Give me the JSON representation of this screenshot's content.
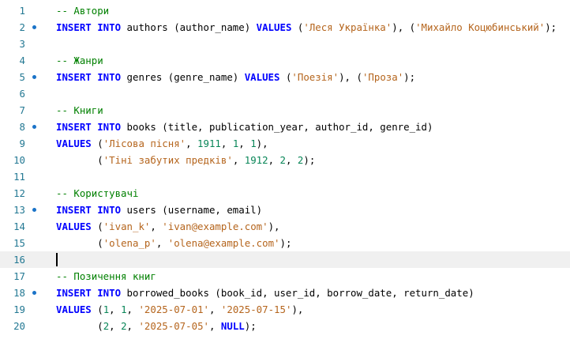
{
  "editor": {
    "lines": [
      {
        "n": "1",
        "tokens": [
          {
            "t": "-- Автори",
            "c": "cm"
          }
        ]
      },
      {
        "n": "2",
        "dot": true,
        "tokens": [
          {
            "t": "INSERT INTO",
            "c": "kw"
          },
          {
            "t": " authors (author_name) ",
            "c": "id"
          },
          {
            "t": "VALUES",
            "c": "kw"
          },
          {
            "t": " (",
            "c": "pn"
          },
          {
            "t": "'Леся Українка'",
            "c": "str"
          },
          {
            "t": "), (",
            "c": "pn"
          },
          {
            "t": "'Михайло Коцюбинський'",
            "c": "str"
          },
          {
            "t": ");",
            "c": "pn"
          }
        ]
      },
      {
        "n": "3",
        "tokens": []
      },
      {
        "n": "4",
        "tokens": [
          {
            "t": "-- Жанри",
            "c": "cm"
          }
        ]
      },
      {
        "n": "5",
        "dot": true,
        "tokens": [
          {
            "t": "INSERT INTO",
            "c": "kw"
          },
          {
            "t": " genres (genre_name) ",
            "c": "id"
          },
          {
            "t": "VALUES",
            "c": "kw"
          },
          {
            "t": " (",
            "c": "pn"
          },
          {
            "t": "'Поезія'",
            "c": "str"
          },
          {
            "t": "), (",
            "c": "pn"
          },
          {
            "t": "'Проза'",
            "c": "str"
          },
          {
            "t": ");",
            "c": "pn"
          }
        ]
      },
      {
        "n": "6",
        "tokens": []
      },
      {
        "n": "7",
        "tokens": [
          {
            "t": "-- Книги",
            "c": "cm"
          }
        ]
      },
      {
        "n": "8",
        "dot": true,
        "tokens": [
          {
            "t": "INSERT INTO",
            "c": "kw"
          },
          {
            "t": " books (title, publication_year, author_id, genre_id)",
            "c": "id"
          }
        ]
      },
      {
        "n": "9",
        "tokens": [
          {
            "t": "VALUES",
            "c": "kw"
          },
          {
            "t": " (",
            "c": "pn"
          },
          {
            "t": "'Лісова пісня'",
            "c": "str"
          },
          {
            "t": ", ",
            "c": "pn"
          },
          {
            "t": "1911",
            "c": "num"
          },
          {
            "t": ", ",
            "c": "pn"
          },
          {
            "t": "1",
            "c": "num"
          },
          {
            "t": ", ",
            "c": "pn"
          },
          {
            "t": "1",
            "c": "num"
          },
          {
            "t": "),",
            "c": "pn"
          }
        ]
      },
      {
        "n": "10",
        "tokens": [
          {
            "t": "       (",
            "c": "pn"
          },
          {
            "t": "'Тіні забутих предків'",
            "c": "str"
          },
          {
            "t": ", ",
            "c": "pn"
          },
          {
            "t": "1912",
            "c": "num"
          },
          {
            "t": ", ",
            "c": "pn"
          },
          {
            "t": "2",
            "c": "num"
          },
          {
            "t": ", ",
            "c": "pn"
          },
          {
            "t": "2",
            "c": "num"
          },
          {
            "t": ");",
            "c": "pn"
          }
        ]
      },
      {
        "n": "11",
        "tokens": []
      },
      {
        "n": "12",
        "tokens": [
          {
            "t": "-- Користувачі",
            "c": "cm"
          }
        ]
      },
      {
        "n": "13",
        "dot": true,
        "tokens": [
          {
            "t": "INSERT INTO",
            "c": "kw"
          },
          {
            "t": " users (username, email)",
            "c": "id"
          }
        ]
      },
      {
        "n": "14",
        "tokens": [
          {
            "t": "VALUES",
            "c": "kw"
          },
          {
            "t": " (",
            "c": "pn"
          },
          {
            "t": "'ivan_k'",
            "c": "str"
          },
          {
            "t": ", ",
            "c": "pn"
          },
          {
            "t": "'ivan@example.com'",
            "c": "str"
          },
          {
            "t": "),",
            "c": "pn"
          }
        ]
      },
      {
        "n": "15",
        "tokens": [
          {
            "t": "       (",
            "c": "pn"
          },
          {
            "t": "'olena_p'",
            "c": "str"
          },
          {
            "t": ", ",
            "c": "pn"
          },
          {
            "t": "'olena@example.com'",
            "c": "str"
          },
          {
            "t": ");",
            "c": "pn"
          }
        ]
      },
      {
        "n": "16",
        "current": true,
        "tokens": []
      },
      {
        "n": "17",
        "tokens": [
          {
            "t": "-- Позичення книг",
            "c": "cm"
          }
        ]
      },
      {
        "n": "18",
        "dot": true,
        "tokens": [
          {
            "t": "INSERT INTO",
            "c": "kw"
          },
          {
            "t": " borrowed_books (book_id, user_id, borrow_date, return_date)",
            "c": "id"
          }
        ]
      },
      {
        "n": "19",
        "tokens": [
          {
            "t": "VALUES",
            "c": "kw"
          },
          {
            "t": " (",
            "c": "pn"
          },
          {
            "t": "1",
            "c": "num"
          },
          {
            "t": ", ",
            "c": "pn"
          },
          {
            "t": "1",
            "c": "num"
          },
          {
            "t": ", ",
            "c": "pn"
          },
          {
            "t": "'2025-07-01'",
            "c": "str"
          },
          {
            "t": ", ",
            "c": "pn"
          },
          {
            "t": "'2025-07-15'",
            "c": "str"
          },
          {
            "t": "),",
            "c": "pn"
          }
        ]
      },
      {
        "n": "20",
        "tokens": [
          {
            "t": "       (",
            "c": "pn"
          },
          {
            "t": "2",
            "c": "num"
          },
          {
            "t": ", ",
            "c": "pn"
          },
          {
            "t": "2",
            "c": "num"
          },
          {
            "t": ", ",
            "c": "pn"
          },
          {
            "t": "'2025-07-05'",
            "c": "str"
          },
          {
            "t": ", ",
            "c": "pn"
          },
          {
            "t": "NULL",
            "c": "kw"
          },
          {
            "t": ");",
            "c": "pn"
          }
        ]
      }
    ]
  }
}
